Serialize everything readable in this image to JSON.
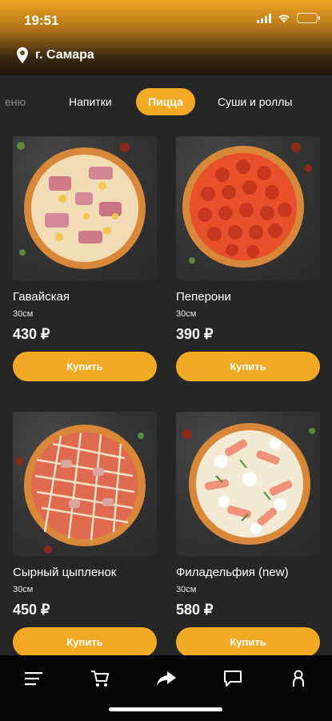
{
  "status_bar": {
    "time": "19:51"
  },
  "location": {
    "city": "г. Самара",
    "icon": "location-pin-icon"
  },
  "tabs": [
    {
      "label": "еню",
      "active": false
    },
    {
      "label": "Напитки",
      "active": false
    },
    {
      "label": "Пицца",
      "active": true
    },
    {
      "label": "Суши и роллы",
      "active": false
    }
  ],
  "products": [
    {
      "name": "Гавайская",
      "size": "30см",
      "price": "430 ₽",
      "buy_label": "Купить",
      "image": "hawaiian-pizza"
    },
    {
      "name": "Пеперони",
      "size": "30см",
      "price": "390 ₽",
      "buy_label": "Купить",
      "image": "pepperoni-pizza"
    },
    {
      "name": "Сырный цыпленок",
      "size": "30см",
      "price": "450 ₽",
      "buy_label": "Купить",
      "image": "cheese-chicken-pizza"
    },
    {
      "name": "Филадельфия (new)",
      "size": "30см",
      "price": "580 ₽",
      "buy_label": "Купить",
      "image": "philadelphia-pizza"
    }
  ],
  "bottom_nav": [
    {
      "icon": "menu-icon"
    },
    {
      "icon": "cart-icon"
    },
    {
      "icon": "share-icon"
    },
    {
      "icon": "chat-icon"
    },
    {
      "icon": "profile-icon"
    }
  ],
  "colors": {
    "accent": "#f2a923",
    "background": "#262626",
    "nav": "#050505"
  }
}
